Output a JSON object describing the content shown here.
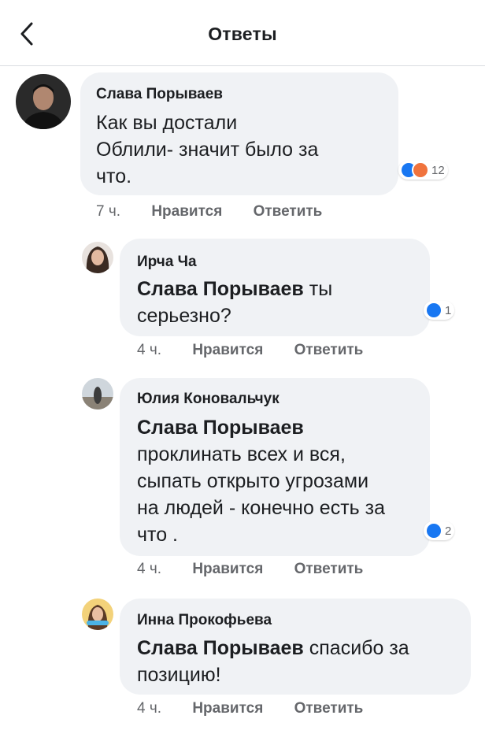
{
  "header": {
    "title": "Ответы"
  },
  "colors": {
    "like_blue": "#1877f2",
    "angry_orange": "#f0733d",
    "bubble_bg": "#f0f2f5",
    "meta_gray": "#65676b"
  },
  "comments": [
    {
      "author": "Слава Порываев",
      "text_lines": [
        "Как вы достали",
        "Облили- значит было за",
        "что."
      ],
      "reaction_icons": [
        "like-icon",
        "angry-icon"
      ],
      "reaction_count": "12",
      "time": "7 ч.",
      "like_label": "Нравится",
      "reply_label": "Ответить"
    },
    {
      "author": "Ирча Ча",
      "mention": "Слава Порываев",
      "text_lines": [
        "ты",
        "серьезно?"
      ],
      "reaction_icons": [
        "like-icon"
      ],
      "reaction_count": "1",
      "time": "4 ч.",
      "like_label": "Нравится",
      "reply_label": "Ответить"
    },
    {
      "author": "Юлия Коновальчук",
      "mention": "Слава Порываев",
      "text_lines": [
        "проклинать всех и вся,",
        "сыпать открыто угрозами",
        "на людей - конечно есть за",
        "что ."
      ],
      "reaction_icons": [
        "like-icon"
      ],
      "reaction_count": "2",
      "time": "4 ч.",
      "like_label": "Нравится",
      "reply_label": "Ответить"
    },
    {
      "author": "Инна Прокофьева",
      "mention": "Слава Порываев",
      "text_lines": [
        "спасибо за",
        "позицию!"
      ],
      "time": "4 ч.",
      "like_label": "Нравится",
      "reply_label": "Ответить"
    }
  ]
}
